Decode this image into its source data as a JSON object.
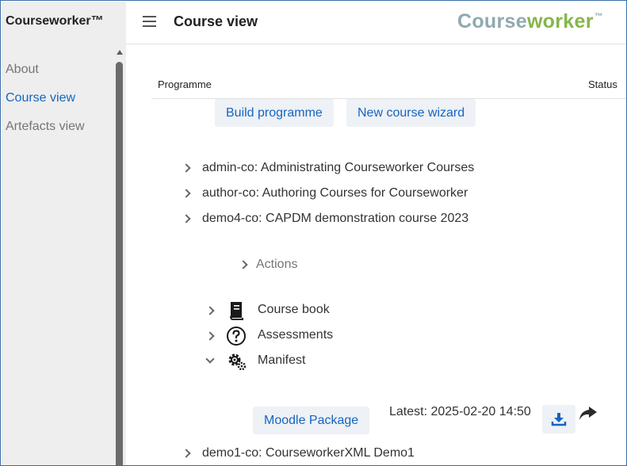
{
  "sidebar": {
    "brand": "Courseworker™",
    "items": [
      {
        "label": "About"
      },
      {
        "label": "Course view"
      },
      {
        "label": "Artefacts view"
      }
    ]
  },
  "header": {
    "title": "Course view",
    "logo_part1": "Course",
    "logo_part2": "worker",
    "logo_tm": "™"
  },
  "table": {
    "col_programme": "Programme",
    "col_status": "Status"
  },
  "buttons": {
    "build": "Build programme",
    "wizard": "New course wizard",
    "moodle": "Moodle Package"
  },
  "courses": [
    {
      "label": "admin-co: Administrating Courseworker Courses"
    },
    {
      "label": "author-co: Authoring Courses for Courseworker"
    },
    {
      "label": "demo4-co: CAPDM demonstration course 2023"
    },
    {
      "label": "demo1-co: CourseworkerXML Demo1"
    }
  ],
  "demo4": {
    "actions_label": "Actions",
    "children": [
      {
        "label": "Course book",
        "icon": "book-icon"
      },
      {
        "label": "Assessments",
        "icon": "question-circle-icon"
      },
      {
        "label": "Manifest",
        "icon": "gears-icon"
      }
    ],
    "latest": "Latest: 2025-02-20 14:50"
  },
  "colors": {
    "accent": "#1565c0",
    "logo_grey": "#8fa9b0",
    "logo_green": "#86b64a",
    "sidebar_bg": "#eeeeee",
    "button_bg": "#eef1f5"
  }
}
